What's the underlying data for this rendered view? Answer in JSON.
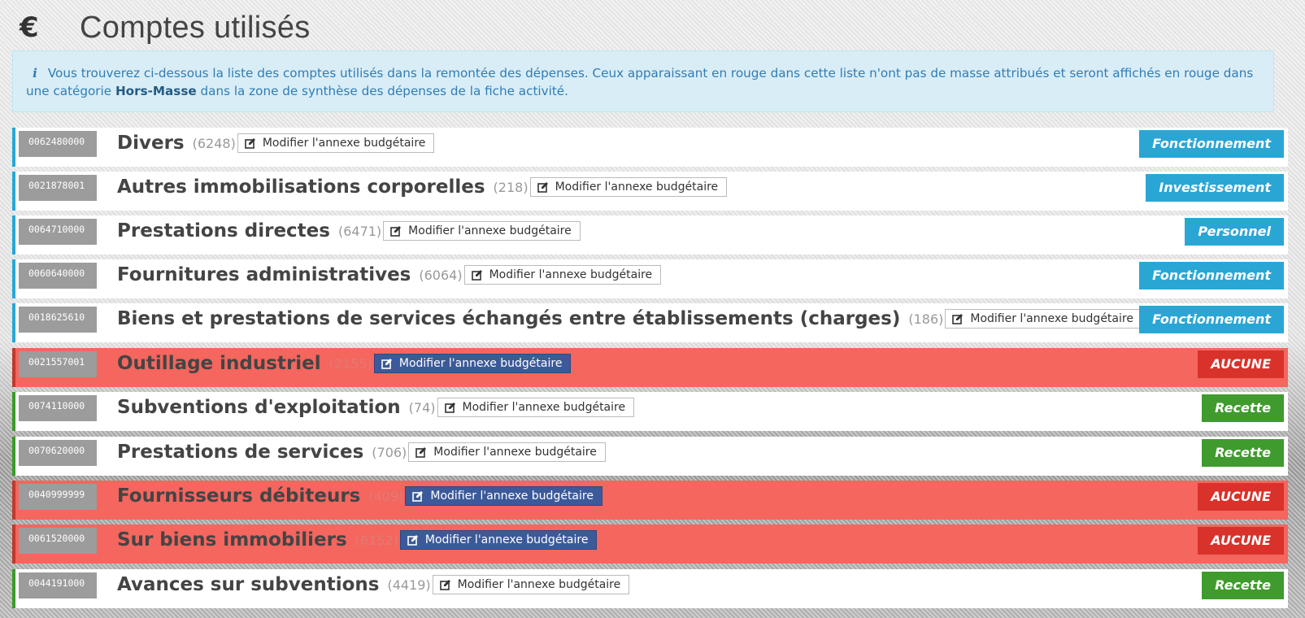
{
  "header": {
    "icon": "euro-icon",
    "title": "Comptes utilisés"
  },
  "info": {
    "icon": "info-icon",
    "text_before": "Vous trouverez ci-dessous la liste des comptes utilisés dans la remontée des dépenses. Ceux apparaissant en rouge dans cette liste n'ont pas de masse attribués et seront affichés en rouge dans une catégorie ",
    "highlight": "Hors-Masse",
    "text_after": " dans la zone de synthèse des dépenses de la fiche activité."
  },
  "edit_label": "Modifier l'annexe budgétaire",
  "colors": {
    "blue": "#2aa6d5",
    "green": "#3f9b2d",
    "red_row": "#f4665e",
    "red_badge": "#d8322b",
    "edit_red": "#3c5a9a",
    "info_bg": "#d9edf7"
  },
  "accounts": [
    {
      "code": "0062480000",
      "name": "Divers",
      "num": "(6248)",
      "type": "Fonctionnement",
      "status": "blue"
    },
    {
      "code": "0021878001",
      "name": "Autres immobilisations corporelles",
      "num": "(218)",
      "type": "Investissement",
      "status": "blue"
    },
    {
      "code": "0064710000",
      "name": "Prestations directes",
      "num": "(6471)",
      "type": "Personnel",
      "status": "blue"
    },
    {
      "code": "0060640000",
      "name": "Fournitures administratives",
      "num": "(6064)",
      "type": "Fonctionnement",
      "status": "blue"
    },
    {
      "code": "0018625610",
      "name": "Biens et prestations de services échangés entre établissements (charges)",
      "num": "(186)",
      "type": "Fonctionnement",
      "status": "blue"
    },
    {
      "code": "0021557001",
      "name": "Outillage industriel",
      "num": "(2155)",
      "type": "AUCUNE",
      "status": "red"
    },
    {
      "code": "0074110000",
      "name": "Subventions d'exploitation",
      "num": "(74)",
      "type": "Recette",
      "status": "green"
    },
    {
      "code": "0070620000",
      "name": "Prestations de services",
      "num": "(706)",
      "type": "Recette",
      "status": "green"
    },
    {
      "code": "0040999999",
      "name": "Fournisseurs débiteurs",
      "num": "(409)",
      "type": "AUCUNE",
      "status": "red"
    },
    {
      "code": "0061520000",
      "name": "Sur biens immobiliers",
      "num": "(6152)",
      "type": "AUCUNE",
      "status": "red"
    },
    {
      "code": "0044191000",
      "name": "Avances sur subventions",
      "num": "(4419)",
      "type": "Recette",
      "status": "green"
    }
  ]
}
